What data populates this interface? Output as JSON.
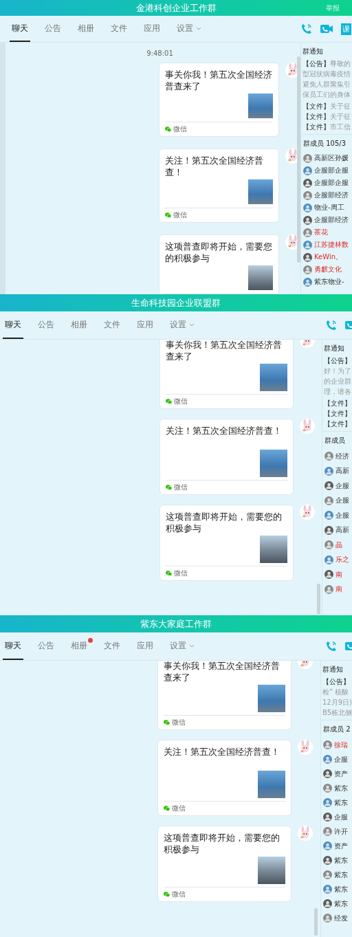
{
  "windows": [
    {
      "title": "金港科创企业工作群",
      "report": "举报",
      "tabs": [
        {
          "label": "聊天",
          "selected": true,
          "badge": false,
          "dropdown": false
        },
        {
          "label": "公告",
          "selected": false,
          "badge": false,
          "dropdown": false
        },
        {
          "label": "相册",
          "selected": false,
          "badge": false,
          "dropdown": false
        },
        {
          "label": "文件",
          "selected": false,
          "badge": false,
          "dropdown": false
        },
        {
          "label": "应用",
          "selected": false,
          "badge": false,
          "dropdown": false
        },
        {
          "label": "设置",
          "selected": false,
          "badge": false,
          "dropdown": true
        }
      ],
      "toolbar": [
        {
          "kind": "phone"
        },
        {
          "kind": "video"
        },
        {
          "kind": "text",
          "label": "课"
        }
      ],
      "timestamp": "9:48:01",
      "messages": [
        {
          "text": "事关你我！第五次全国经济普查来了",
          "kind": "news",
          "source": "微信"
        },
        {
          "text": "关注！第五次全国经济普查！",
          "kind": "news",
          "source": "微信"
        },
        {
          "text": "这项普查即将开始，需要您的积极参与",
          "kind": "city"
        }
      ],
      "notice": {
        "title": "群通知",
        "label": "【公告】",
        "first": "尊敬的",
        "lines": [
          "型冠状病毒疫情",
          "避免人群聚集引",
          "保员工们的身体"
        ],
        "files": [
          {
            "label": "【文件】",
            "text": "关于征"
          },
          {
            "label": "【文件】",
            "text": "关于征"
          },
          {
            "label": "【文件】",
            "text": "市工信"
          }
        ]
      },
      "members": {
        "title": "群成员 105/3",
        "list": [
          {
            "name": "高新区孙媛",
            "highlighted": false
          },
          {
            "name": "企服部企服",
            "highlighted": false
          },
          {
            "name": "企服部企服",
            "highlighted": false
          },
          {
            "name": "企服部经济",
            "highlighted": false
          },
          {
            "name": "物业-周工",
            "highlighted": false
          },
          {
            "name": "企服部经济",
            "highlighted": false
          },
          {
            "name": "茶花",
            "highlighted": true
          },
          {
            "name": "江苏捷林数",
            "highlighted": true
          },
          {
            "name": "KeWin。",
            "highlighted": true
          },
          {
            "name": "勇麒文化",
            "highlighted": true
          },
          {
            "name": "紫东物业-",
            "highlighted": false
          }
        ]
      }
    },
    {
      "title": "生命科技园企业联盟群",
      "tabs": [
        {
          "label": "聊天",
          "selected": true,
          "badge": false,
          "dropdown": false
        },
        {
          "label": "公告",
          "selected": false,
          "badge": false,
          "dropdown": false
        },
        {
          "label": "相册",
          "selected": false,
          "badge": false,
          "dropdown": false
        },
        {
          "label": "文件",
          "selected": false,
          "badge": false,
          "dropdown": false
        },
        {
          "label": "应用",
          "selected": false,
          "badge": false,
          "dropdown": false
        },
        {
          "label": "设置",
          "selected": false,
          "badge": false,
          "dropdown": true
        }
      ],
      "toolbar": [
        {
          "kind": "phone"
        },
        {
          "kind": "video"
        }
      ],
      "messages": [
        {
          "text": "事关你我！第五次全国经济普查来了",
          "kind": "news",
          "source": "微信"
        },
        {
          "text": "关注！第五次全国经济普查！",
          "kind": "news",
          "source": "微信"
        },
        {
          "text": "这项普查即将开始，需要您的积极参与",
          "kind": "city",
          "source": "微信"
        }
      ],
      "notice": {
        "title": "群通知",
        "label": "【公告】",
        "lines": [
          "好！为了",
          "的企业群",
          "理，请各"
        ],
        "files": [
          {
            "label": "【文件】"
          },
          {
            "label": "【文件】"
          },
          {
            "label": "【文件】"
          }
        ]
      },
      "members": {
        "title": "群成员",
        "list": [
          {
            "name": "经济",
            "highlighted": false
          },
          {
            "name": "高新",
            "highlighted": false
          },
          {
            "name": "企服",
            "highlighted": false
          },
          {
            "name": "企服",
            "highlighted": false
          },
          {
            "name": "企服",
            "highlighted": false
          },
          {
            "name": "高新",
            "highlighted": false
          },
          {
            "name": "晶",
            "highlighted": true
          },
          {
            "name": "乐之",
            "highlighted": true
          },
          {
            "name": "南",
            "highlighted": true
          },
          {
            "name": "南",
            "highlighted": true
          }
        ]
      }
    },
    {
      "title": "紫东大家庭工作群",
      "tabs": [
        {
          "label": "聊天",
          "selected": true,
          "badge": false,
          "dropdown": false
        },
        {
          "label": "公告",
          "selected": false,
          "badge": false,
          "dropdown": false
        },
        {
          "label": "相册",
          "selected": false,
          "badge": true,
          "dropdown": false
        },
        {
          "label": "文件",
          "selected": false,
          "badge": false,
          "dropdown": false
        },
        {
          "label": "应用",
          "selected": false,
          "badge": false,
          "dropdown": false
        },
        {
          "label": "设置",
          "selected": false,
          "badge": false,
          "dropdown": true
        }
      ],
      "toolbar": [
        {
          "kind": "phone"
        },
        {
          "kind": "video"
        }
      ],
      "messages": [
        {
          "text": "事关你我！第五次全国经济普查来了",
          "kind": "news",
          "source": "微信"
        },
        {
          "text": "关注！第五次全国经济普查！",
          "kind": "news",
          "source": "微信"
        },
        {
          "text": "这项普查即将开始，需要您的积极参与",
          "kind": "city",
          "source": "微信"
        }
      ],
      "notice": {
        "title": "群通知",
        "label": "【公告】",
        "lines": [
          "检” 核酸",
          "12月9日)",
          "B5栋北侧"
        ]
      },
      "members": {
        "title": "群成员 2",
        "list": [
          {
            "name": "徐瑞",
            "highlighted": true
          },
          {
            "name": "企服",
            "highlighted": false
          },
          {
            "name": "资产",
            "highlighted": false
          },
          {
            "name": "紫东",
            "highlighted": false
          },
          {
            "name": "紫东",
            "highlighted": false
          },
          {
            "name": "企服",
            "highlighted": false
          },
          {
            "name": "许开",
            "highlighted": false
          },
          {
            "name": "资产",
            "highlighted": false
          },
          {
            "name": "紫东",
            "highlighted": false
          },
          {
            "name": "紫东",
            "highlighted": false
          },
          {
            "name": "紫东",
            "highlighted": false
          },
          {
            "name": "紫东",
            "highlighted": false
          },
          {
            "name": "经发",
            "highlighted": false
          }
        ]
      }
    }
  ]
}
